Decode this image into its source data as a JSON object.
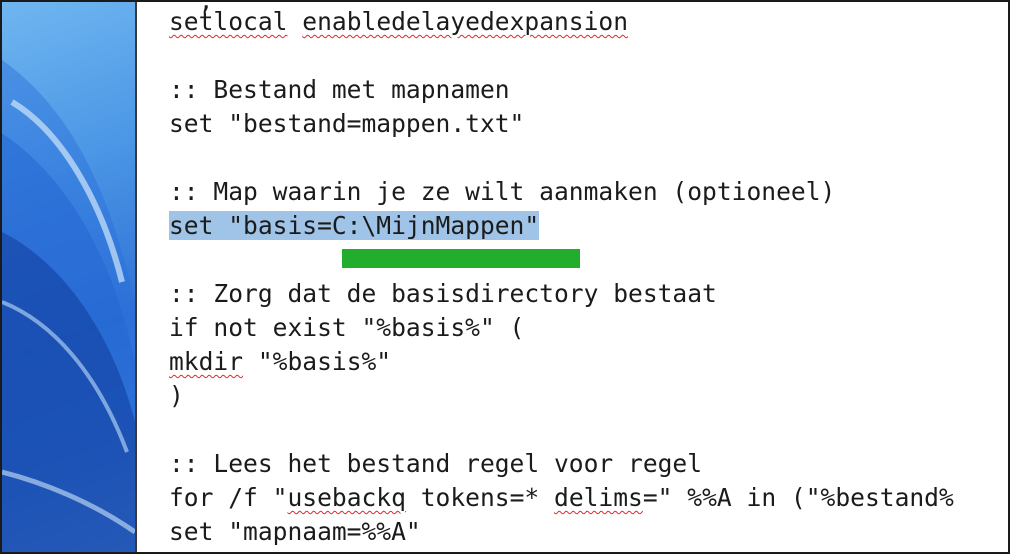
{
  "editor": {
    "lines": [
      {
        "text": "setlocal enabledelayedexpansion"
      },
      {
        "text": ""
      },
      {
        "text": ":: Bestand met mapnamen"
      },
      {
        "text": "set \"bestand=mappen.txt\""
      },
      {
        "text": ""
      },
      {
        "text": ":: Map waarin je ze wilt aanmaken (optioneel)"
      },
      {
        "text": "set \"basis=C:\\MijnMappen\""
      },
      {
        "text": ""
      },
      {
        "text": ":: Zorg dat de basisdirectory bestaat"
      },
      {
        "text": "if not exist \"%basis%\" ("
      },
      {
        "text": "mkdir \"%basis%\""
      },
      {
        "text": ")"
      },
      {
        "text": ""
      },
      {
        "text": ":: Lees het bestand regel voor regel"
      },
      {
        "text": "for /f \"usebackq tokens=* delims=\" %%A in (\"%bestand%"
      },
      {
        "text": "set \"mapnaam=%%A\""
      }
    ],
    "tokens": {
      "setlocal": "setlocal",
      "enabledelayedexpansion": "enabledelayedexpansion",
      "mkdir": "mkdir",
      "mkdir_rest": " \"%basis%\"",
      "for_prefix": "for /f \"",
      "usebackq": "usebackq",
      "for_mid": " tokens=* ",
      "delims": "delims",
      "for_suffix": "=\" %%A in (\"%bestand%",
      "selected_line": "set \"basis=C:\\MijnMappen\""
    }
  },
  "colors": {
    "text": "#1b1b1b",
    "selection": "#9fc4e7",
    "highlight_bar": "#22ad2c",
    "spellcheck": "#e0262b"
  }
}
